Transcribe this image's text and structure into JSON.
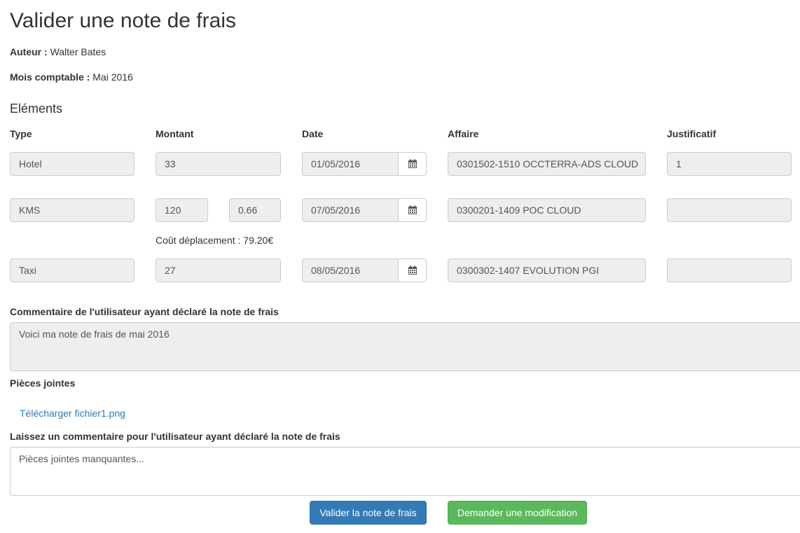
{
  "page": {
    "title": "Valider une note de frais",
    "author_label": "Auteur :",
    "author": "Walter Bates",
    "month_label": "Mois comptable :",
    "month": "Mai 2016"
  },
  "elements": {
    "heading": "Eléments",
    "headers": {
      "type": "Type",
      "amount": "Montant",
      "date": "Date",
      "project": "Affaire",
      "receipt": "Justificatif"
    },
    "rows": [
      {
        "type": "Hotel",
        "amount": "33",
        "date": "01/05/2016",
        "project": "0301502-1510 OCCTERRA-ADS CLOUD",
        "receipt": "1"
      },
      {
        "type": "KMS",
        "amount": "120",
        "rate": "0.66",
        "date": "07/05/2016",
        "project": "0300201-1409 POC CLOUD",
        "receipt": "",
        "travel_cost": "Coût déplacement : 79.20€"
      },
      {
        "type": "Taxi",
        "amount": "27",
        "date": "08/05/2016",
        "project": "0300302-1407 EVOLUTION PGI",
        "receipt": ""
      }
    ],
    "calendar_icon": "calendar-icon"
  },
  "user_comment": {
    "label": "Commentaire de l'utilisateur ayant déclaré la note de frais",
    "value": "Voici ma note de frais de mai 2016"
  },
  "attachments": {
    "label": "Pièces jointes",
    "link": "Télécharger fichier1.png"
  },
  "reviewer_comment": {
    "label": "Laissez un commentaire pour l'utilisateur ayant déclaré la note de frais",
    "placeholder": "Pièces jointes manquantes..."
  },
  "actions": {
    "validate": "Valider la note de frais",
    "request_change": "Demander une modification"
  },
  "colors": {
    "primary": "#337ab7",
    "success": "#5cb85c",
    "readonly_bg": "#eeeeee"
  }
}
